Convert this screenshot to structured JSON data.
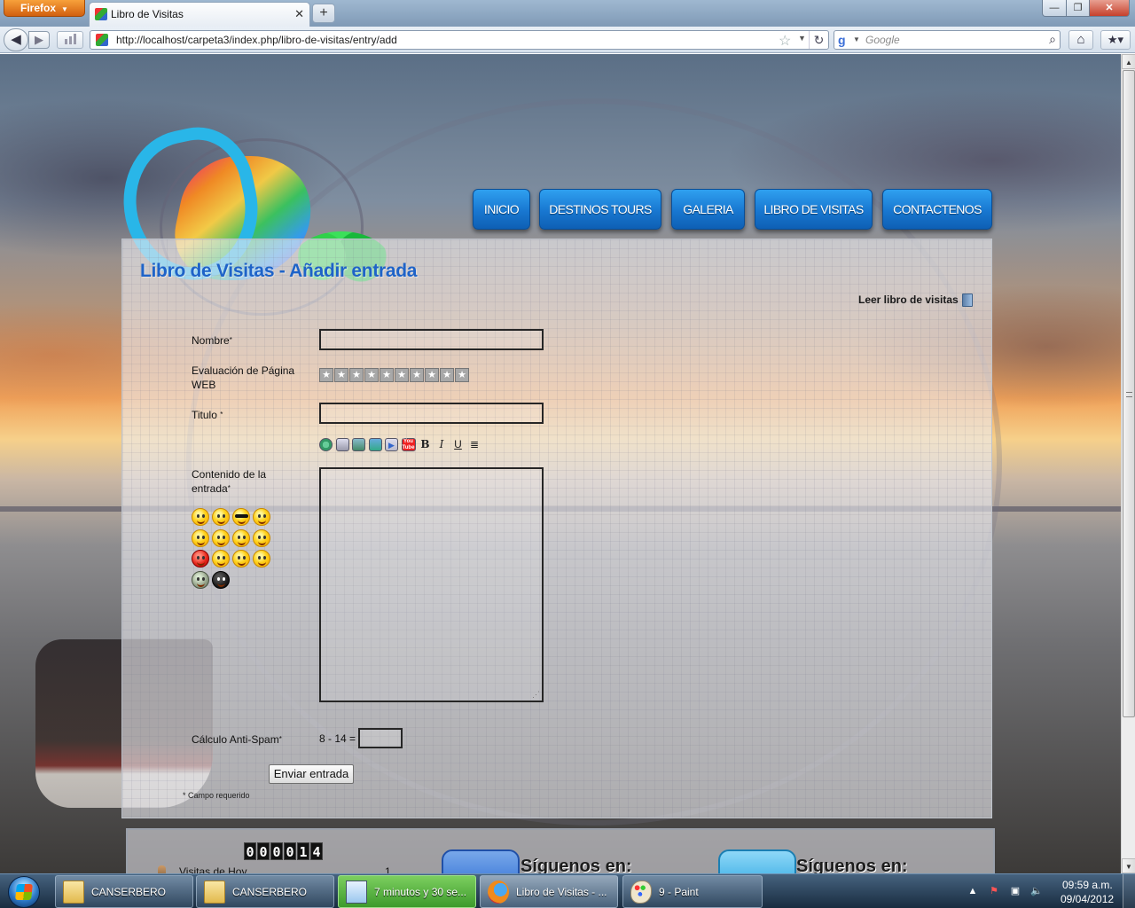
{
  "browser": {
    "app_button": "Firefox",
    "tab_title": "Libro de Visitas",
    "new_tab": "+",
    "url": "http://localhost/carpeta3/index.php/libro-de-visitas/entry/add",
    "search_placeholder": "Google",
    "window_controls": {
      "minimize": "—",
      "maximize": "❐",
      "close": "✕"
    }
  },
  "menu": [
    {
      "label": "INICIO"
    },
    {
      "label": "DESTINOS TOURS"
    },
    {
      "label": "GALERIA"
    },
    {
      "label": "LIBRO DE VISITAS"
    },
    {
      "label": "CONTACTENOS"
    }
  ],
  "guestbook": {
    "title": "Libro de Visitas - Añadir entrada",
    "read_link": "Leer libro de visitas",
    "fields": {
      "name_label": "Nombre",
      "rating_label": "Evaluación de Página WEB",
      "rating_stars": 10,
      "title_label": "Titulo",
      "content_label": "Contenido de la entrada",
      "captcha_label": "Cálculo Anti-Spam",
      "captcha_question": "8 - 14 =",
      "name_value": "",
      "title_value": "",
      "content_value": "",
      "captcha_value": ""
    },
    "required_mark": "*",
    "submit_label": "Enviar entrada",
    "required_note": "* Campo requerido",
    "toolbar_icons": [
      "link-icon",
      "email-icon",
      "image-icon",
      "image-gallery-icon",
      "video-icon",
      "youtube-icon",
      "bold-icon",
      "italic-icon",
      "underline-icon",
      "align-icon"
    ],
    "toolbar_text": {
      "bold": "B",
      "italic": "I",
      "underline": "U",
      "align": "≣",
      "youtube": "You Tube",
      "video": "▶"
    },
    "smileys": [
      "smile",
      "grin",
      "cool",
      "laugh",
      "kiss",
      "angry",
      "shock",
      "wink",
      "devil",
      "blush",
      "tongue",
      "sad",
      "alien",
      "ninja"
    ]
  },
  "footer": {
    "counter_digits": [
      "0",
      "0",
      "0",
      "0",
      "1",
      "4"
    ],
    "visits_today_label": "Visitas de Hoy",
    "visits_today_value": "1",
    "follow_text_1": "Síguenos en:",
    "follow_text_2": "Síguenos en:"
  },
  "taskbar": {
    "tasks": [
      {
        "label": "CANSERBERO"
      },
      {
        "label": "CANSERBERO"
      },
      {
        "label": "7 minutos y 30 se..."
      },
      {
        "label": "Libro de Visitas - ..."
      },
      {
        "label": "9 - Paint"
      }
    ],
    "clock_time": "09:59 a.m.",
    "clock_date": "09/04/2012"
  }
}
